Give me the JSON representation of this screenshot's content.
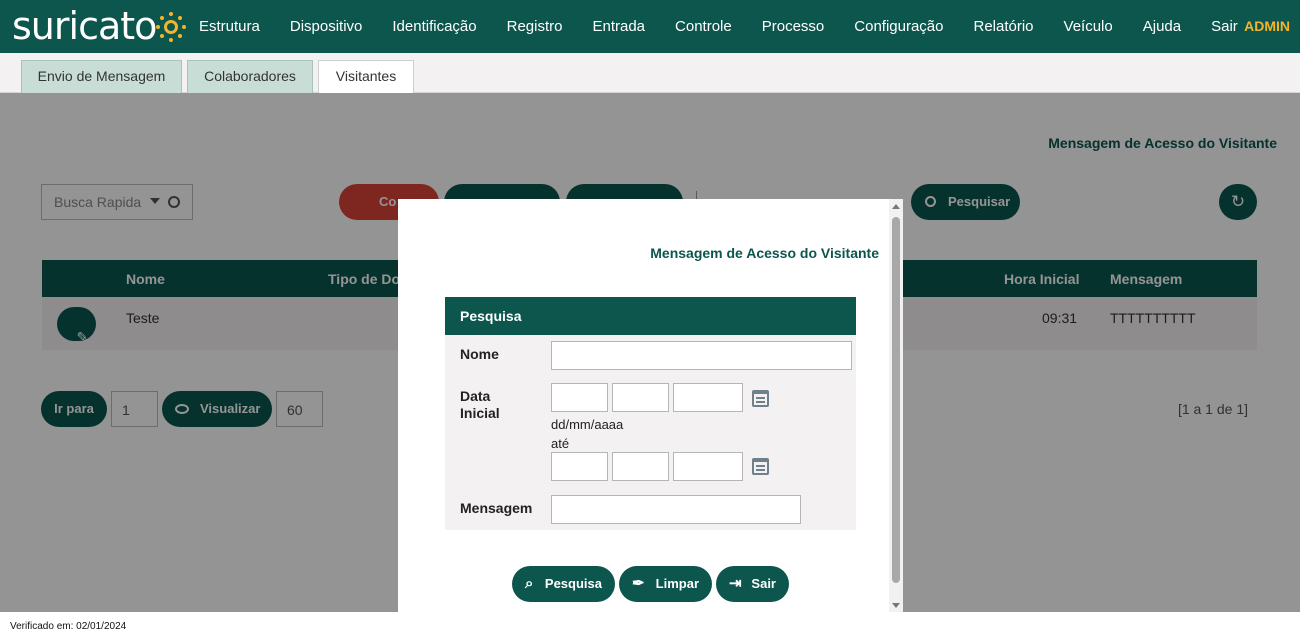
{
  "app": {
    "logo_text": "suricato",
    "user": "ADMIN"
  },
  "nav": [
    "Estrutura",
    "Dispositivo",
    "Identificação",
    "Registro",
    "Entrada",
    "Controle",
    "Processo",
    "Configuração",
    "Relatório",
    "Veículo",
    "Ajuda",
    "Sair"
  ],
  "tabs": [
    "Envio de Mensagem",
    "Colaboradores",
    "Visitantes"
  ],
  "active_tab": "Visitantes",
  "background_page": {
    "title": "Mensagem de Acesso do Visitante",
    "quick_search_placeholder": "Busca Rapida",
    "toolbar_buttons": [
      "Co",
      "",
      ""
    ],
    "search_button": "Pesquisar",
    "grid": {
      "columns": [
        "Nome",
        "Tipo de Do",
        "Hora Inicial",
        "Mensagem"
      ],
      "rows": [
        {
          "nome": "Teste",
          "hora_inicial": "09:31",
          "mensagem": "TTTTTTTTTT"
        }
      ]
    },
    "pager": {
      "goto_label": "Ir para",
      "page": "1",
      "view_label": "Visualizar",
      "page_size": "60",
      "range": "[1 a 1 de 1]"
    }
  },
  "modal": {
    "title": "Mensagem de Acesso do Visitante",
    "panel_title": "Pesquisa",
    "fields": {
      "nome_label": "Nome",
      "data_label_line1": "Data",
      "data_label_line2": "Inicial",
      "date_hint": "dd/mm/aaaa",
      "ate": "até",
      "mensagem_label": "Mensagem"
    },
    "buttons": {
      "search": "Pesquisa",
      "clear": "Limpar",
      "exit": "Sair"
    }
  },
  "footer": {
    "verified": "Verificado em: 02/01/2024"
  },
  "colors": {
    "brand": "#0c564e",
    "accent": "#f2b62b",
    "danger": "#d9443a"
  }
}
